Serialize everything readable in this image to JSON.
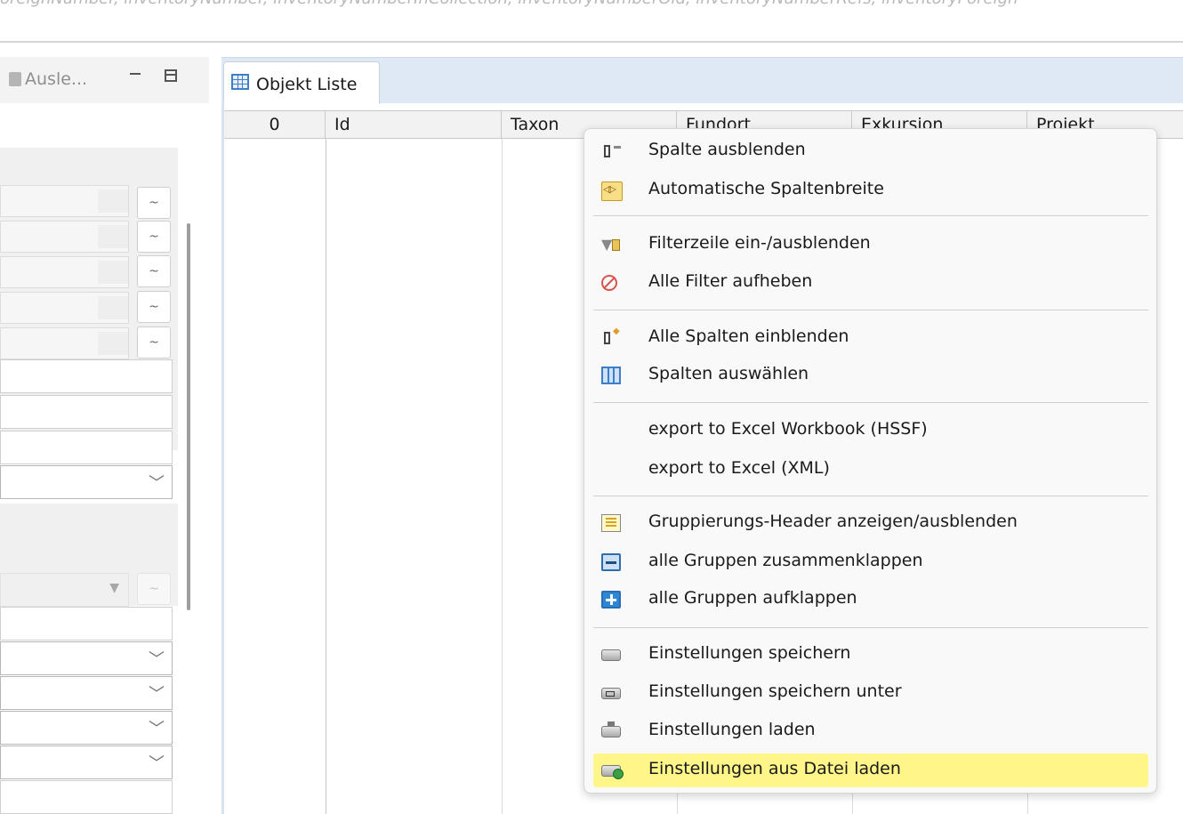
{
  "top_strip": {
    "crumbs": "oreignNumber, inventoryNumber, inventoryNumberInCollection, inventoryNumberOld, inventoryNumberRefs, inventoryForeign"
  },
  "left_panel": {
    "tab_label": "Ausle..."
  },
  "object_list": {
    "tab_label": "Objekt Liste",
    "columns": [
      "0",
      "Id",
      "Taxon",
      "Fundort",
      "Exkursion",
      "Projekt"
    ]
  },
  "context_menu": {
    "items": [
      {
        "label": "Spalte ausblenden",
        "icon": "hide-column-icon"
      },
      {
        "label": "Automatische Spaltenbreite",
        "icon": "auto-width-icon"
      },
      {
        "label": "Filterzeile ein-/ausblenden",
        "icon": "filter-row-icon"
      },
      {
        "label": "Alle Filter aufheben",
        "icon": "clear-filter-icon"
      },
      {
        "label": "Alle Spalten einblenden",
        "icon": "show-columns-icon"
      },
      {
        "label": "Spalten auswählen",
        "icon": "choose-columns-icon"
      },
      {
        "label": "export to Excel Workbook (HSSF)",
        "icon": ""
      },
      {
        "label": "export to Excel (XML)",
        "icon": ""
      },
      {
        "label": "Gruppierungs-Header anzeigen/ausblenden",
        "icon": "group-header-icon"
      },
      {
        "label": "alle Gruppen zusammenklappen",
        "icon": "collapse-icon"
      },
      {
        "label": "alle Gruppen aufklappen",
        "icon": "expand-icon"
      },
      {
        "label": "Einstellungen speichern",
        "icon": "save-settings-icon"
      },
      {
        "label": "Einstellungen speichern unter",
        "icon": "save-settings-as-icon"
      },
      {
        "label": "Einstellungen laden",
        "icon": "load-settings-icon"
      },
      {
        "label": "Einstellungen aus Datei laden",
        "icon": "load-settings-file-icon"
      }
    ],
    "highlighted_item": "Einstellungen aus Datei laden",
    "highlight_color": "#fff68a"
  }
}
